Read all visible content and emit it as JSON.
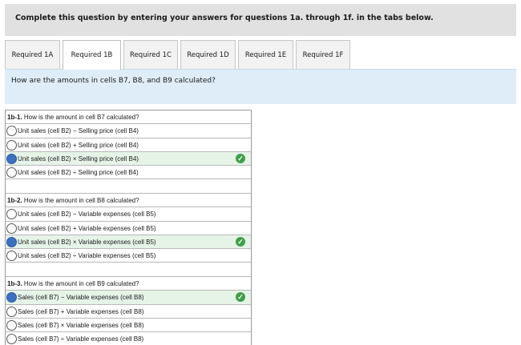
{
  "instruction": "Complete this question by entering your answers for questions 1a. through 1f. in the tabs below.",
  "tabs": [
    {
      "label": "Required 1A",
      "active": false
    },
    {
      "label": "Required 1B",
      "active": true
    },
    {
      "label": "Required 1C",
      "active": false
    },
    {
      "label": "Required 1D",
      "active": false
    },
    {
      "label": "Required 1E",
      "active": false
    },
    {
      "label": "Required 1F",
      "active": false
    }
  ],
  "question": "How are the amounts in cells B7, B8, and B9 calculated?",
  "sections": [
    {
      "num": "1b-1.",
      "prompt": "How is the amount in cell B7 calculated?",
      "options": [
        "Unit sales (cell B2) − Selling price (cell B4)",
        "Unit sales (cell B2) + Selling price (cell B4)",
        "Unit sales (cell B2) × Selling price (cell B4)",
        "Unit sales (cell B2) ÷ Selling price (cell B4)"
      ],
      "selected": 2
    },
    {
      "num": "1b-2.",
      "prompt": "How is the amount in cell B8 calculated?",
      "options": [
        "Unit sales (cell B2) − Variable expenses (cell B5)",
        "Unit sales (cell B2) + Variable expenses (cell B5)",
        "Unit sales (cell B2) × Variable expenses (cell B5)",
        "Unit sales (cell B2) ÷ Variable expenses (cell B5)"
      ],
      "selected": 2
    },
    {
      "num": "1b-3.",
      "prompt": "How is the amount in cell B9 calculated?",
      "options": [
        "Sales (cell B7) − Variable expenses (cell B8)",
        "Sales (cell B7) + Variable expenses (cell B8)",
        "Sales (cell B7) × Variable expenses (cell B8)",
        "Sales (cell B7) ÷ Variable expenses (cell B8)"
      ],
      "selected": 0
    }
  ],
  "check_icon": "check-circle-icon",
  "colors": {
    "selected_radio": "#3d6fc4",
    "correct_bg": "#e6f4e7",
    "check": "#3ea04a",
    "question_bar": "#deedf8"
  }
}
